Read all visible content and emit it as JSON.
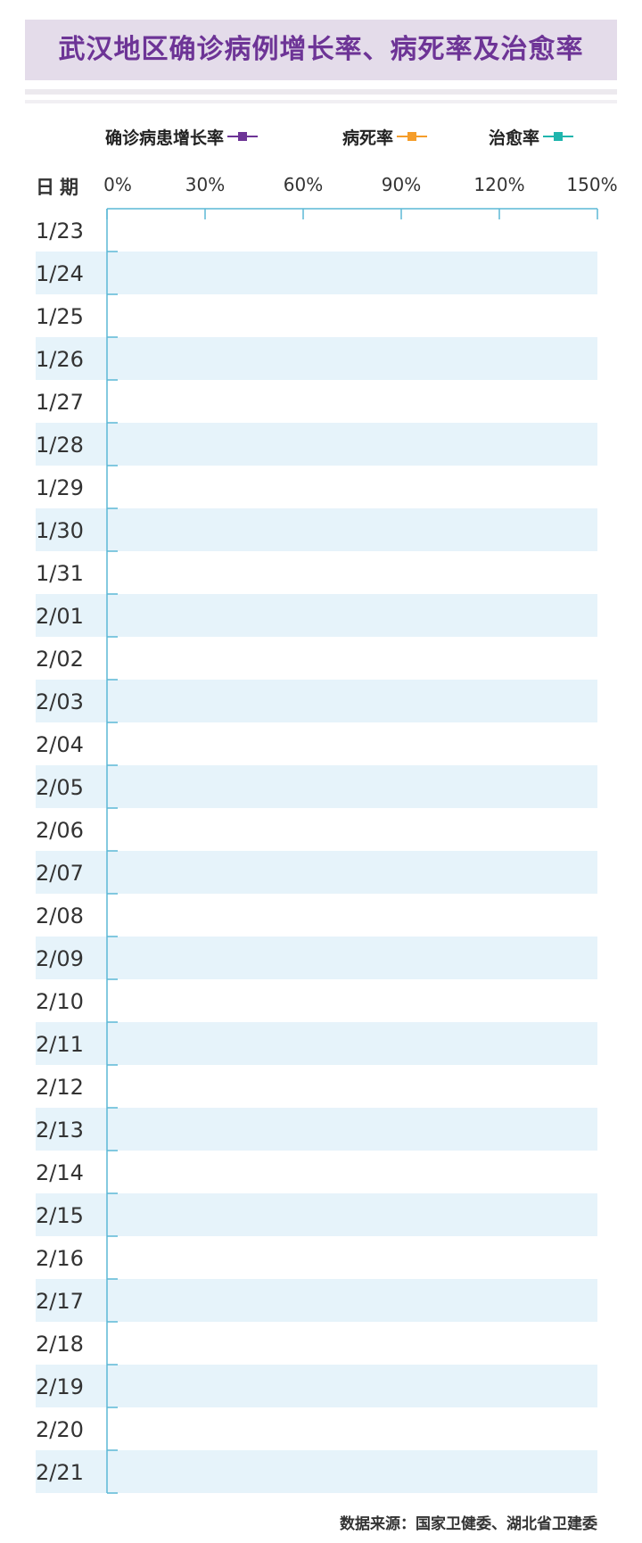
{
  "title": "武汉地区确诊病例增长率、病死率及治愈率",
  "source": "数据来源：国家卫健委、湖北省卫建委",
  "date_header": "日期",
  "legend": [
    {
      "label": "确诊病患增长率",
      "color": "#6d3496",
      "icon": "purple-square-marker"
    },
    {
      "label": "病死率",
      "color": "#f59d2a",
      "icon": "orange-square-marker"
    },
    {
      "label": "治愈率",
      "color": "#1fb5ad",
      "icon": "teal-square-marker"
    }
  ],
  "colors": {
    "title_bg": "#e4dcea",
    "title_text": "#6d3496",
    "row_stripe": "#e6f3fa",
    "axis": "#5cb8d6"
  },
  "chart_data": {
    "type": "line",
    "orientation": "horizontal",
    "title": "武汉地区确诊病例增长率、病死率及治愈率",
    "xlabel": "",
    "ylabel": "日期",
    "x_ticks": [
      "0%",
      "30%",
      "60%",
      "90%",
      "120%",
      "150%"
    ],
    "xlim": [
      0,
      150
    ],
    "categories": [
      "1/23",
      "1/24",
      "1/25",
      "1/26",
      "1/27",
      "1/28",
      "1/29",
      "1/30",
      "1/31",
      "2/01",
      "2/02",
      "2/03",
      "2/04",
      "2/05",
      "2/06",
      "2/07",
      "2/08",
      "2/09",
      "2/10",
      "2/11",
      "2/12",
      "2/13",
      "2/14",
      "2/15",
      "2/16",
      "2/17",
      "2/18",
      "2/19",
      "2/20",
      "2/21"
    ],
    "series": [
      {
        "name": "确诊病患增长率",
        "values": []
      },
      {
        "name": "病死率",
        "values": []
      },
      {
        "name": "治愈率",
        "values": []
      }
    ],
    "grid": false,
    "legend_position": "top"
  }
}
